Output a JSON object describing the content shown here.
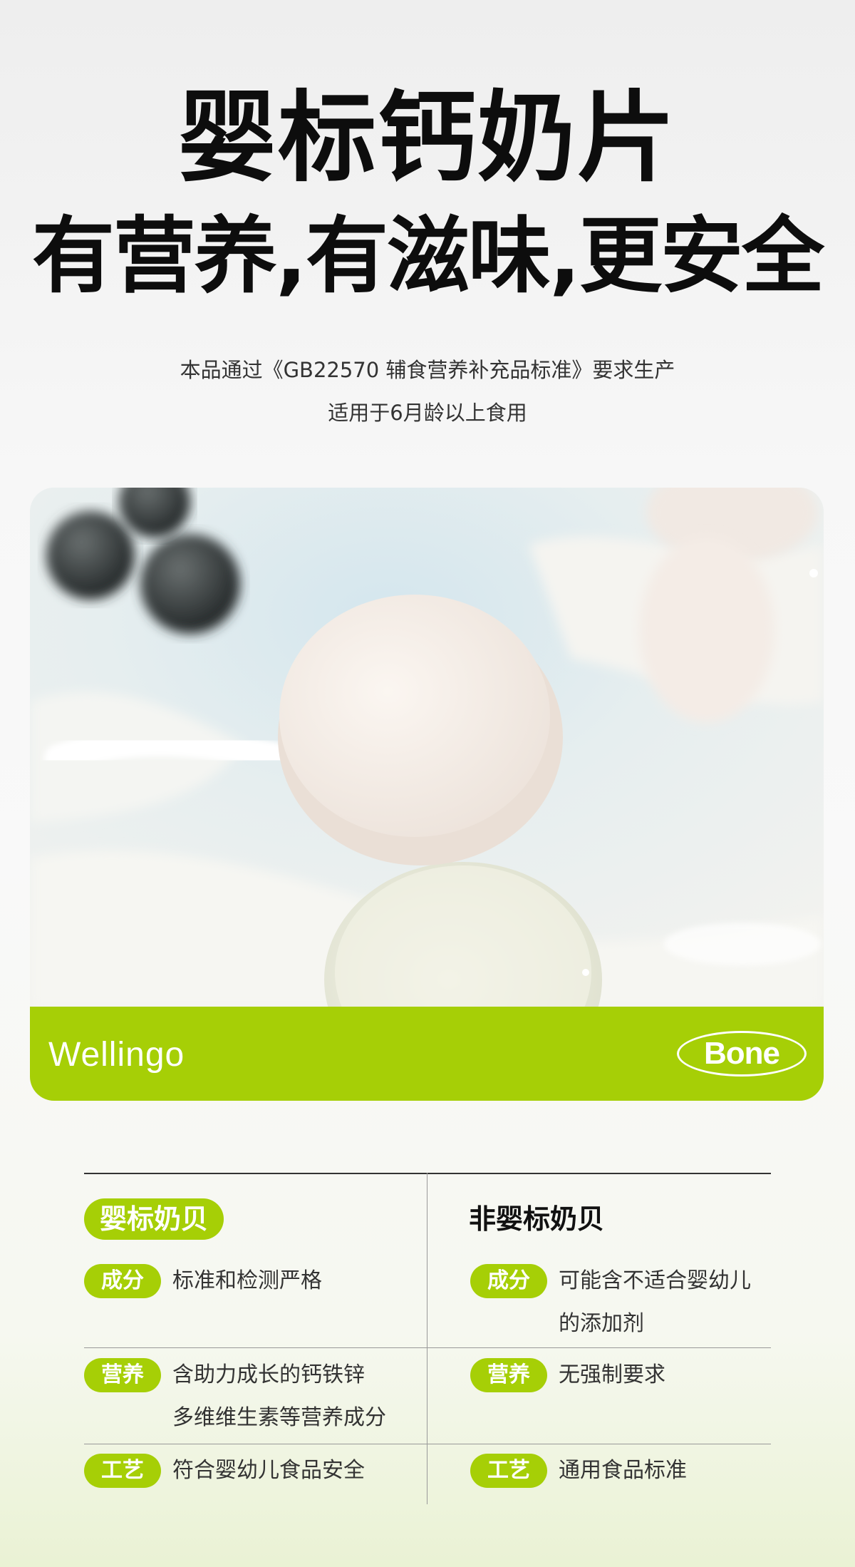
{
  "header": {
    "title": "婴标钙奶片",
    "subtitle": "有营养,有滋味,更安全",
    "desc_line1": "本品通过《GB22570 辅食营养补充品标准》要求生产",
    "desc_line2": "适用于6月龄以上食用"
  },
  "hero": {
    "brand": "Wellingo",
    "badge": "Bone",
    "band_color": "#a6cf06"
  },
  "compare": {
    "left_header": "婴标奶贝",
    "right_header": "非婴标奶贝",
    "rows": [
      {
        "tag": "成分",
        "left": [
          "标准和检测严格"
        ],
        "right": [
          "可能含不适合婴幼儿",
          "的添加剂"
        ]
      },
      {
        "tag": "营养",
        "left": [
          "含助力成长的钙铁锌",
          "多维维生素等营养成分"
        ],
        "right": [
          "无强制要求"
        ]
      },
      {
        "tag": "工艺",
        "left": [
          "符合婴幼儿食品安全"
        ],
        "right": [
          "通用食品标准"
        ]
      }
    ]
  }
}
